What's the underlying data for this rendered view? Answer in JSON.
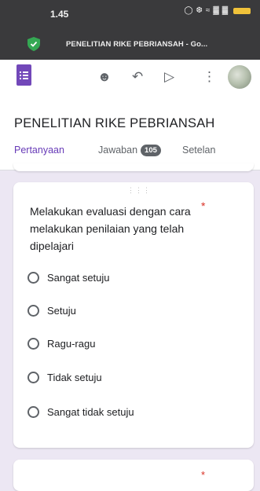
{
  "status_bar": {
    "time": "1.45",
    "icons": [
      "alarm-icon",
      "mute-icon",
      "wifi-icon",
      "signal-icon",
      "signal-icon",
      "battery-icon"
    ]
  },
  "browser_tab": {
    "title": "PENELITIAN RIKE PEBRIANSAH - Go...",
    "icon": "shield-check-icon"
  },
  "toolbar": {
    "icons": [
      "forms-logo-icon",
      "palette-icon",
      "undo-icon",
      "send-icon",
      "more-vert-icon",
      "avatar"
    ]
  },
  "document": {
    "title": "PENELITIAN RIKE PEBRIANSAH"
  },
  "tabs": [
    {
      "label": "Pertanyaan",
      "active": true
    },
    {
      "label": "Jawaban",
      "badge": "105"
    },
    {
      "label": "Setelan"
    }
  ],
  "question_card": {
    "text": "Melakukan evaluasi dengan cara melakukan penilaian yang telah dipelajari",
    "required_mark": "*",
    "options": [
      "Sangat setuju",
      "Setuju",
      "Ragu-ragu",
      "Tidak setuju",
      "Sangat tidak setuju"
    ]
  },
  "next_card": {
    "required_mark": "*"
  },
  "colors": {
    "accent": "#673ab7",
    "required": "#d93025",
    "status_bar": "#3a3a3c",
    "background": "#ece7f3"
  }
}
